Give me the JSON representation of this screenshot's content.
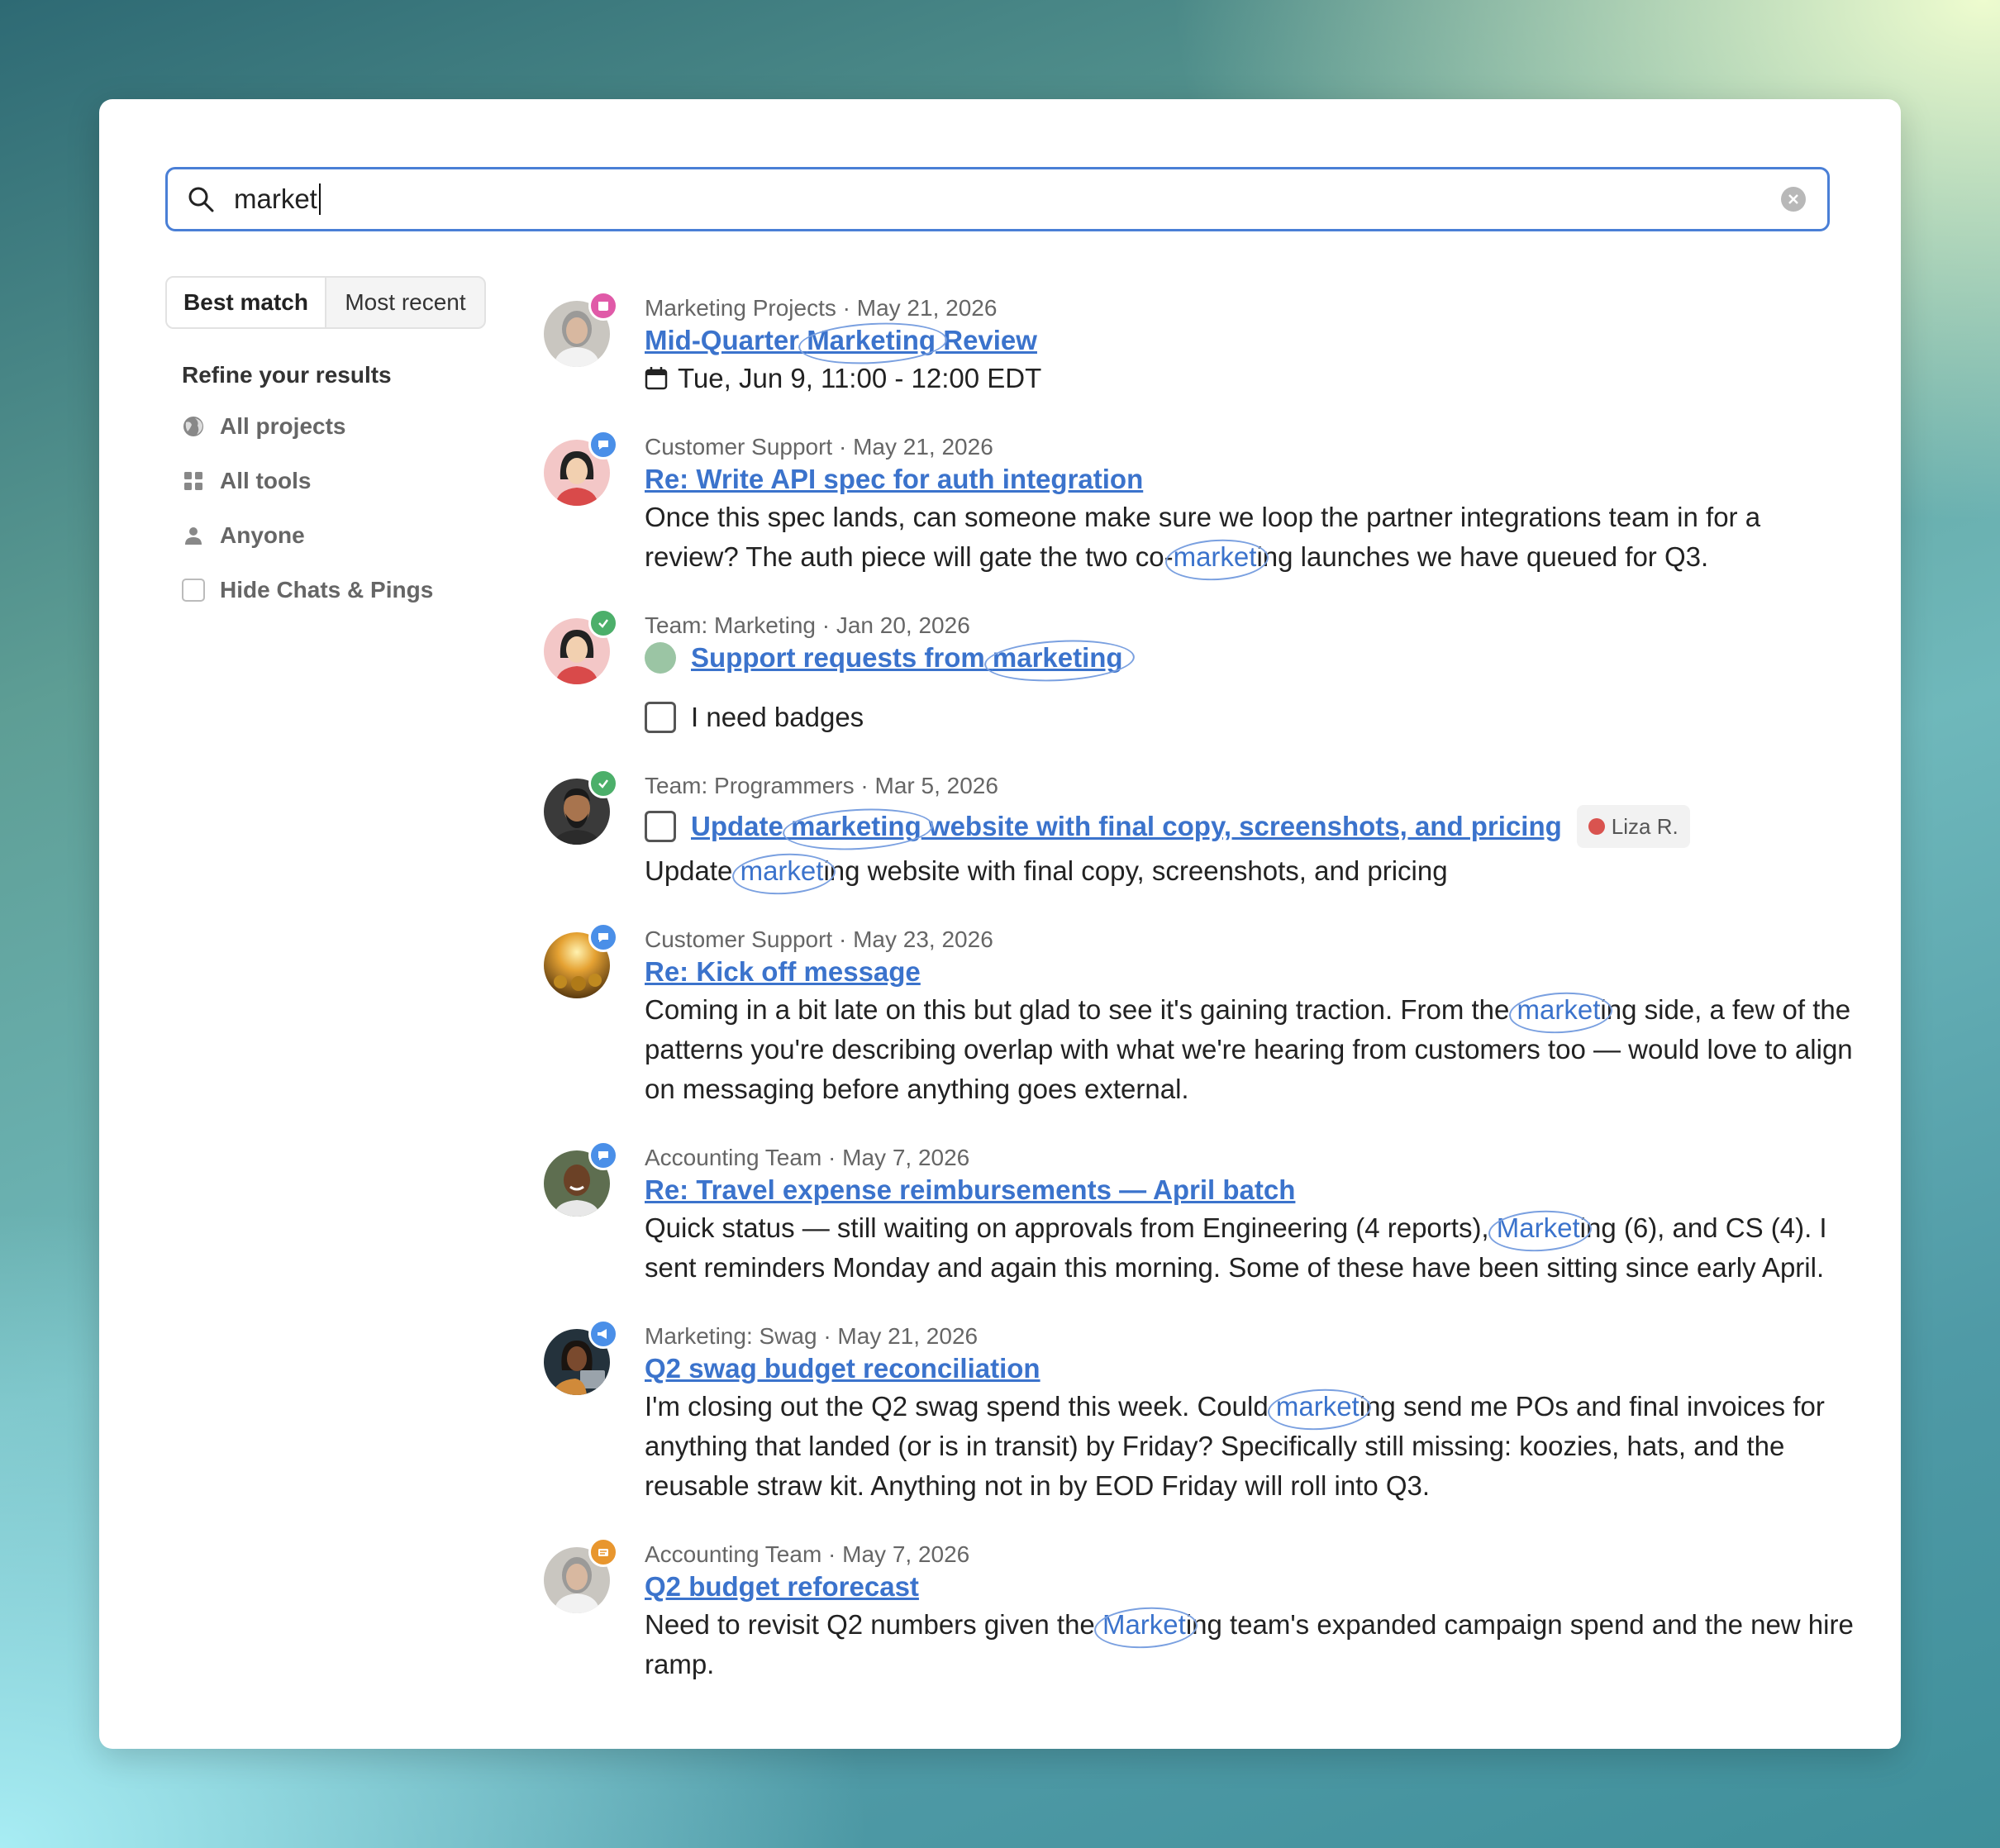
{
  "search": {
    "value": "market"
  },
  "sort": {
    "best_match": "Best match",
    "most_recent": "Most recent"
  },
  "refine": {
    "title": "Refine your results",
    "filters": [
      "All projects",
      "All tools",
      "Anyone",
      "Hide Chats & Pings"
    ]
  },
  "results": [
    {
      "meta": "Marketing Projects · May 21, 2026",
      "title_pre": "Mid-Quarter ",
      "title_hl": "Marketing",
      "title_post": " Review",
      "detail": "Tue, Jun 9, 11:00 - 12:00 EDT",
      "badge_color": "#e05aa8",
      "badge_icon": "calendar-icon"
    },
    {
      "meta": "Customer Support · May 21, 2026",
      "title": "Re: Write API spec for auth integration",
      "body_pre": "Once this spec lands, can someone make sure we loop the partner integrations team in for a review? The auth piece will gate the two co-",
      "body_hl": "market",
      "body_post": "ing launches we have queued for Q3.",
      "badge_color": "#4a8fe8",
      "badge_icon": "chat-icon"
    },
    {
      "meta": "Team: Marketing · Jan 20, 2026",
      "title_pre": "Support requests from ",
      "title_hl": "marketing",
      "todo": "I need badges",
      "badge_color": "#4caf6a",
      "badge_icon": "check-icon"
    },
    {
      "meta": "Team: Programmers · Mar 5, 2026",
      "title_pre": "Update ",
      "title_hl": "marketing",
      "title_post": " website with final copy, screenshots, and pricing",
      "assignee": "Liza R.",
      "body_pre": "Update ",
      "body_hl": "market",
      "body_post": "ing website with final copy, screenshots, and pricing",
      "badge_color": "#4caf6a",
      "badge_icon": "check-icon"
    },
    {
      "meta": "Customer Support · May 23, 2026",
      "title": "Re: Kick off message",
      "body_pre": "Coming in a bit late on this but glad to see it's gaining traction. From the ",
      "body_hl": "market",
      "body_post": "ing side, a few of the patterns you're describing overlap with what we're hearing from customers too — would love to align on messaging before anything goes external.",
      "badge_color": "#4a8fe8",
      "badge_icon": "chat-icon"
    },
    {
      "meta": "Accounting Team · May 7, 2026",
      "title": "Re: Travel expense reimbursements — April batch",
      "body_pre": "Quick status — still waiting on approvals from Engineering (4 reports), ",
      "body_hl": "Market",
      "body_post": "ing (6), and CS (4). I sent reminders Monday and again this morning. Some of these have been sitting since early April.",
      "badge_color": "#4a8fe8",
      "badge_icon": "chat-icon"
    },
    {
      "meta": "Marketing: Swag · May 21, 2026",
      "title": "Q2 swag budget reconciliation",
      "body_pre": "I'm closing out the Q2 swag spend this week. Could ",
      "body_hl": "market",
      "body_post": "ing send me POs and final invoices for anything that landed (or is in transit) by Friday? Specifically still missing: koozies, hats, and the reusable straw kit. Anything not in by EOD Friday will roll into Q3.",
      "badge_color": "#4a8fe8",
      "badge_icon": "megaphone-icon"
    },
    {
      "meta": "Accounting Team · May 7, 2026",
      "title": "Q2 budget reforecast",
      "body_pre": "Need to revisit Q2 numbers given the ",
      "body_hl": "Market",
      "body_post": "ing team's expanded campaign spend and the new hire ramp.",
      "badge_color": "#e8962e",
      "badge_icon": "doc-icon"
    }
  ]
}
